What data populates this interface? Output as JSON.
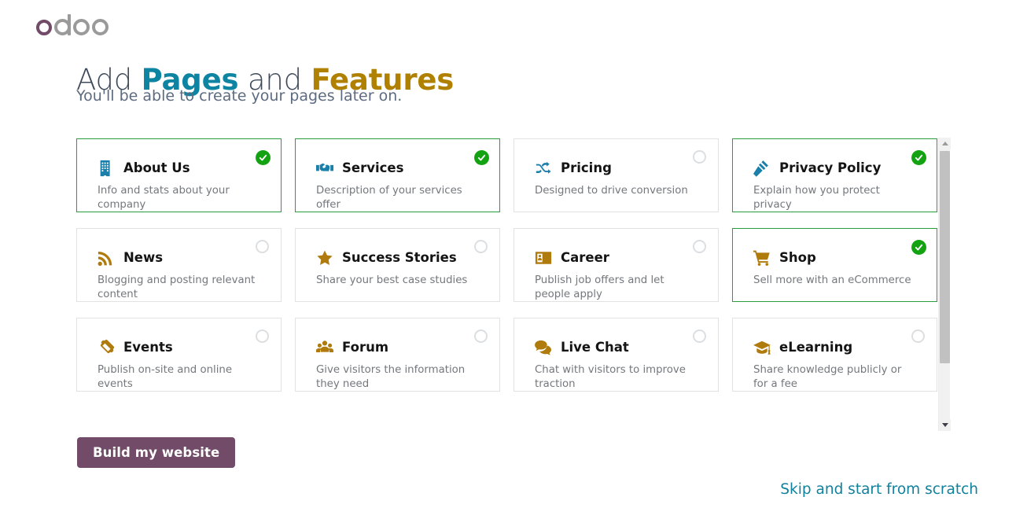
{
  "brand": {
    "logo_text": "odoo",
    "logo_accent_color": "#714b67",
    "logo_gray_color": "#9a9a9a"
  },
  "header": {
    "title_part1": "Add ",
    "title_accent1": "Pages",
    "title_part2": " and ",
    "title_accent2": "Features",
    "subtitle": "You'll be able to create your pages later on.",
    "accent1_color": "#0e84a3",
    "accent2_color": "#b08001"
  },
  "features": [
    {
      "name": "About Us",
      "description": "Info and stats about your company",
      "icon": "building-icon",
      "icon_color": "#1a7fab",
      "selected": true
    },
    {
      "name": "Services",
      "description": "Description of your services offer",
      "icon": "handshake-icon",
      "icon_color": "#1a7fab",
      "selected": true
    },
    {
      "name": "Pricing",
      "description": "Designed to drive conversion",
      "icon": "shuffle-icon",
      "icon_color": "#1a7fab",
      "selected": false
    },
    {
      "name": "Privacy Policy",
      "description": "Explain how you protect privacy",
      "icon": "gavel-icon",
      "icon_color": "#1a7fab",
      "selected": true
    },
    {
      "name": "News",
      "description": "Blogging and posting relevant content",
      "icon": "rss-icon",
      "icon_color": "#b07b0d",
      "selected": false
    },
    {
      "name": "Success Stories",
      "description": "Share your best case studies",
      "icon": "star-icon",
      "icon_color": "#b07b0d",
      "selected": false
    },
    {
      "name": "Career",
      "description": "Publish job offers and let people apply",
      "icon": "id-card-icon",
      "icon_color": "#b07b0d",
      "selected": false
    },
    {
      "name": "Shop",
      "description": "Sell more with an eCommerce",
      "icon": "shopping-cart-icon",
      "icon_color": "#b07b0d",
      "selected": true
    },
    {
      "name": "Events",
      "description": "Publish on-site and online events",
      "icon": "ticket-icon",
      "icon_color": "#b07b0d",
      "selected": false
    },
    {
      "name": "Forum",
      "description": "Give visitors the information they need",
      "icon": "users-group-icon",
      "icon_color": "#b07b0d",
      "selected": false
    },
    {
      "name": "Live Chat",
      "description": "Chat with visitors to improve traction",
      "icon": "comments-icon",
      "icon_color": "#b07b0d",
      "selected": false
    },
    {
      "name": "eLearning",
      "description": "Share knowledge publicly or for a fee",
      "icon": "graduation-cap-icon",
      "icon_color": "#b07b0d",
      "selected": false
    }
  ],
  "scrollbar": {
    "up_arrow_icon": "chevron-up-icon",
    "down_arrow_icon": "chevron-down-icon"
  },
  "footer": {
    "build_label": "Build my website",
    "build_color": "#714b67",
    "skip_label": "Skip and start from scratch",
    "skip_color": "#12819e"
  }
}
